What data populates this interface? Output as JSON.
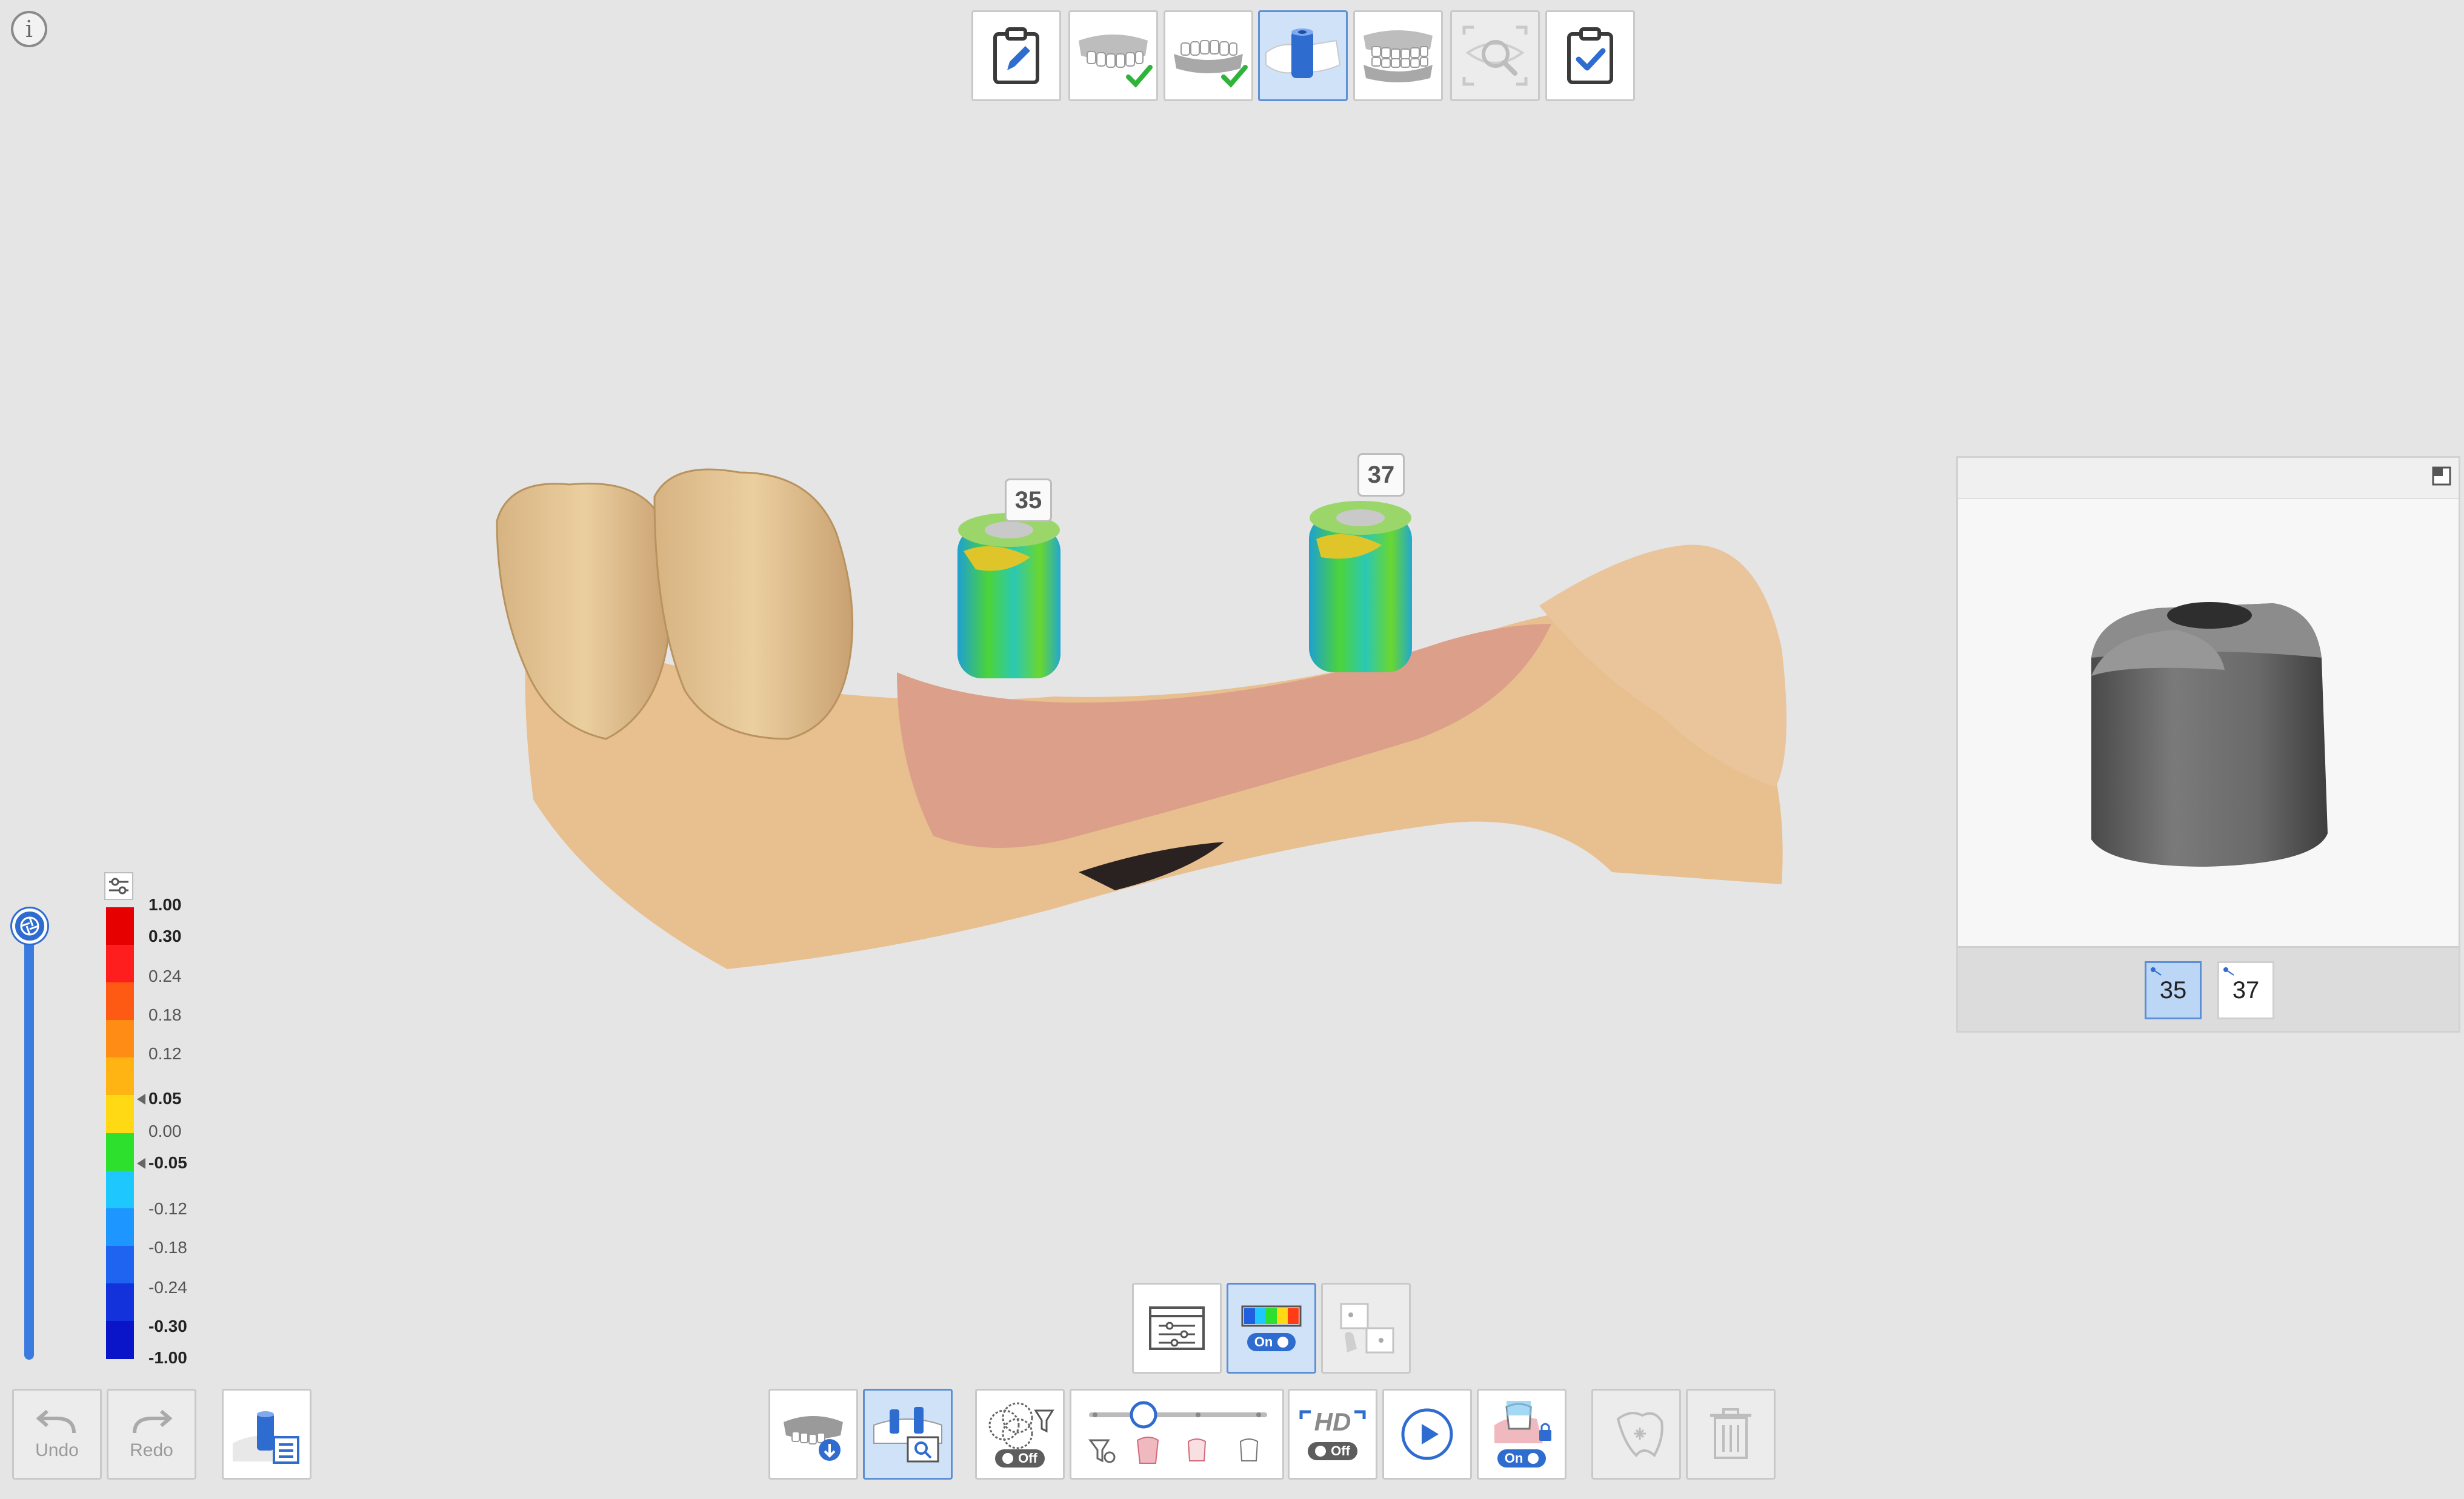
{
  "info": {
    "icon": "info-icon",
    "glyph": "i"
  },
  "workflow_steps": [
    {
      "name": "prescription-step",
      "icon": "clipboard-edit-icon"
    },
    {
      "name": "maxilla-scan-step",
      "icon": "upper-jaw-icon",
      "done": true
    },
    {
      "name": "mandible-scan-step",
      "icon": "lower-jaw-icon",
      "done": true
    },
    {
      "name": "scanbody-step",
      "icon": "scan-body-icon",
      "active": true
    },
    {
      "name": "occlusion-step",
      "icon": "occlusion-icon"
    },
    {
      "name": "analysis-step",
      "icon": "inspect-icon",
      "disabled": true
    },
    {
      "name": "complete-step",
      "icon": "clipboard-check-icon"
    }
  ],
  "tooth_tags": {
    "left": "35",
    "right": "37"
  },
  "color_scale": {
    "labels": [
      {
        "text": "1.00",
        "bold": true
      },
      {
        "text": "0.30",
        "bold": true
      },
      {
        "text": "0.24"
      },
      {
        "text": "0.18"
      },
      {
        "text": "0.12"
      },
      {
        "text": "0.05",
        "bold": true
      },
      {
        "text": "0.00"
      },
      {
        "text": "-0.05",
        "bold": true
      },
      {
        "text": "-0.12"
      },
      {
        "text": "-0.18"
      },
      {
        "text": "-0.24"
      },
      {
        "text": "-0.30",
        "bold": true
      },
      {
        "text": "-1.00",
        "bold": true
      }
    ],
    "colors": [
      "#e60000",
      "#ff1e1e",
      "#ff5a14",
      "#ff8c14",
      "#ffb414",
      "#ffd914",
      "#2ee02e",
      "#1ec8ff",
      "#1e96ff",
      "#1e64f0",
      "#1432dc",
      "#0a14c8"
    ]
  },
  "preview": {
    "teeth": [
      {
        "label": "35",
        "active": true
      },
      {
        "label": "37",
        "active": false
      }
    ]
  },
  "mid_tools": {
    "deviation_toggle": "On"
  },
  "bottom_left": {
    "undo_label": "Undo",
    "redo_label": "Redo"
  },
  "bottom_tools": {
    "filter_toggle": "Off",
    "hd_label": "HD",
    "hd_toggle": "Off",
    "lock_toggle": "On"
  }
}
